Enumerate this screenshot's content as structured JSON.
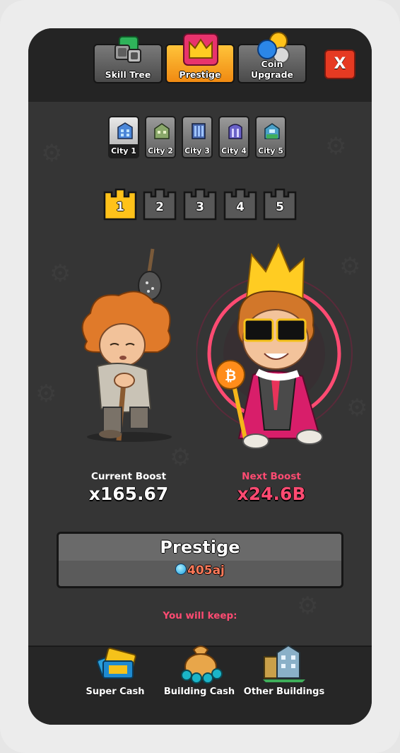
{
  "tabs": [
    {
      "label": "Skill Tree",
      "icon": "skill-tree-icon",
      "active": false
    },
    {
      "label": "Prestige",
      "icon": "crown-icon",
      "active": true
    },
    {
      "label": "Coin Upgrade",
      "icon": "coins-icon",
      "active": false
    }
  ],
  "close_label": "X",
  "cities": [
    {
      "label": "City 1",
      "active": true
    },
    {
      "label": "City 2",
      "active": false
    },
    {
      "label": "City 3",
      "active": false
    },
    {
      "label": "City 4",
      "active": false
    },
    {
      "label": "City 5",
      "active": false
    }
  ],
  "levels": [
    {
      "label": "1",
      "active": true
    },
    {
      "label": "2",
      "active": false
    },
    {
      "label": "3",
      "active": false
    },
    {
      "label": "4",
      "active": false
    },
    {
      "label": "5",
      "active": false
    }
  ],
  "current_boost": {
    "label": "Current Boost",
    "value": "x165.67"
  },
  "next_boost": {
    "label": "Next Boost",
    "value": "x24.6B"
  },
  "prestige_button": {
    "title": "Prestige",
    "cost": "405aj",
    "cost_icon": "gem-icon"
  },
  "keep": {
    "label": "You will keep:",
    "items": [
      {
        "label": "Super Cash",
        "icon": "super-cash-icon"
      },
      {
        "label": "Building Cash",
        "icon": "money-bag-icon"
      },
      {
        "label": "Other Buildings",
        "icon": "buildings-icon"
      }
    ]
  },
  "colors": {
    "accent_orange": "#f5a623",
    "next_boost_pink": "#ff4b72",
    "close_red": "#e63a22",
    "cost_text": "#ff7a5a"
  }
}
